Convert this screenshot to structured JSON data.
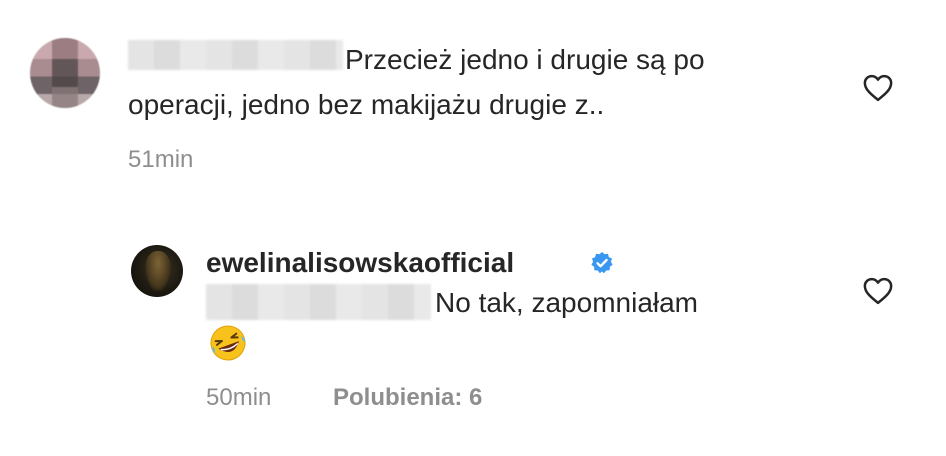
{
  "comments": [
    {
      "text_line1": "Przecież jedno i drugie są po",
      "text_line2": "operacji, jedno bez makijażu drugie z..",
      "time": "51min"
    },
    {
      "username": "ewelinalisowskaofficial",
      "verified": true,
      "text": "No tak, zapomniałam",
      "emoji": "🤣",
      "time": "50min",
      "likes_label": "Polubienia: 6"
    }
  ],
  "icons": {
    "like": "heart-outline-icon",
    "verified": "verified-badge-icon",
    "emoji": "rofl-emoji-icon"
  },
  "colors": {
    "text": "#262626",
    "meta": "#8e8e8e",
    "verified": "#3897f0",
    "emoji": "#f8c21c"
  }
}
